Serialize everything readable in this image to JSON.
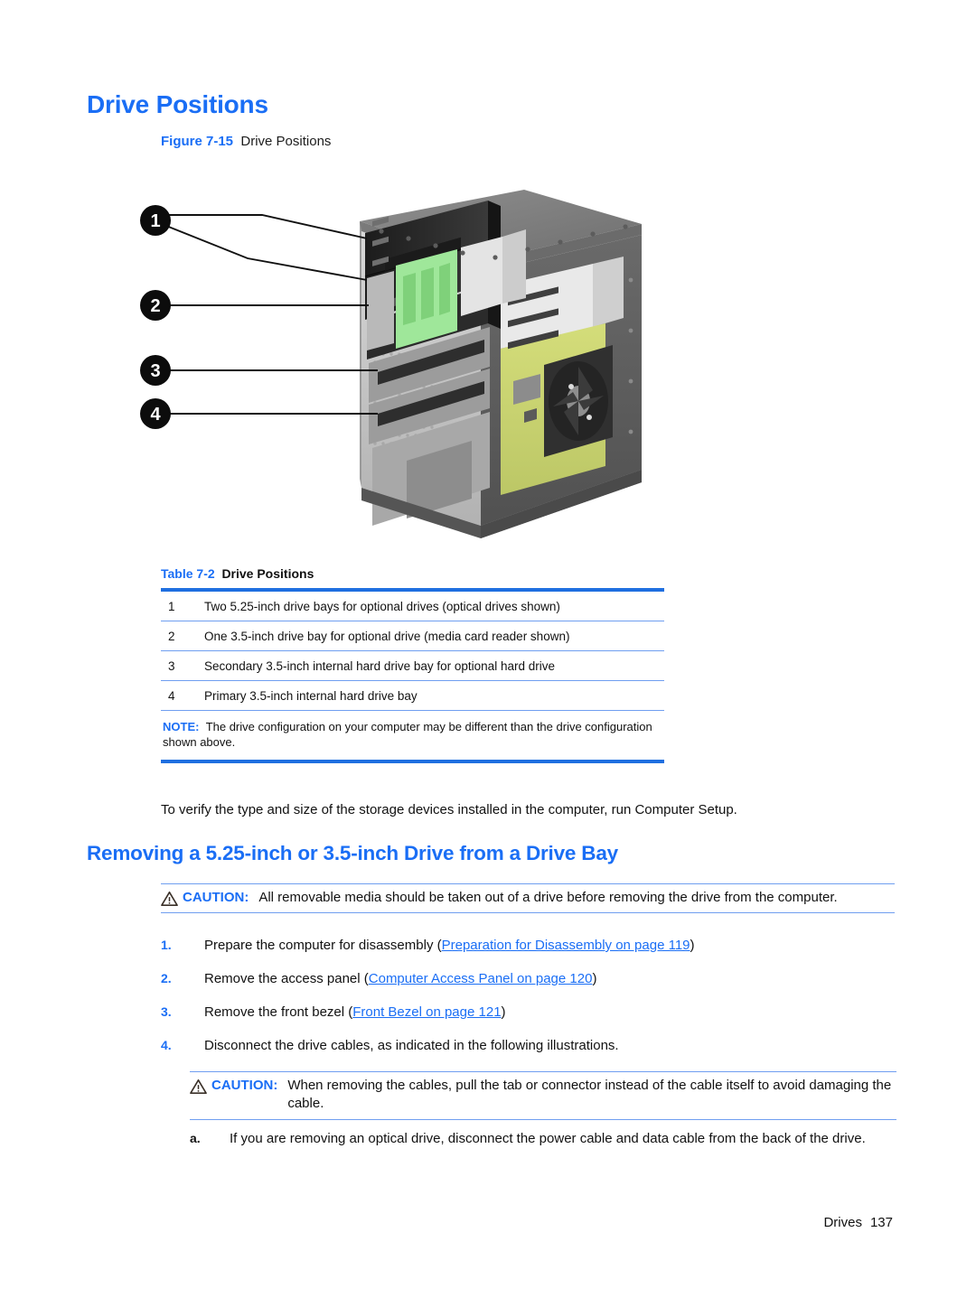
{
  "page": {
    "heading": "Drive Positions",
    "figure": {
      "number": "Figure 7-15",
      "title": "Drive Positions"
    },
    "illustration": {
      "alt_name": "computer-chassis-drive-positions-diagram",
      "callouts": [
        "1",
        "2",
        "3",
        "4"
      ]
    },
    "table": {
      "number": "Table 7-2",
      "title": "Drive Positions",
      "rows": [
        {
          "num": "1",
          "text": "Two 5.25-inch drive bays for optional drives (optical drives shown)"
        },
        {
          "num": "2",
          "text": "One 3.5-inch drive bay for optional drive (media card reader shown)"
        },
        {
          "num": "3",
          "text": "Secondary 3.5-inch internal hard drive bay for optional hard drive"
        },
        {
          "num": "4",
          "text": "Primary 3.5-inch internal hard drive bay"
        }
      ],
      "note_label": "NOTE:",
      "note_text": "The drive configuration on your computer may be different than the drive configuration shown above."
    },
    "body_paragraph": "To verify the type and size of the storage devices installed in the computer, run Computer Setup.",
    "section_heading": "Removing a 5.25-inch or 3.5-inch Drive from a Drive Bay",
    "caution_1": {
      "label": "CAUTION:",
      "text": "All removable media should be taken out of a drive before removing the drive from the computer."
    },
    "steps": [
      {
        "num": "1.",
        "prefix": "Prepare the computer for disassembly (",
        "link": "Preparation for Disassembly on page 119",
        "suffix": ")"
      },
      {
        "num": "2.",
        "prefix": "Remove the access panel (",
        "link": "Computer Access Panel on page 120",
        "suffix": ")"
      },
      {
        "num": "3.",
        "prefix": "Remove the front bezel (",
        "link": "Front Bezel on page 121",
        "suffix": ")"
      },
      {
        "num": "4.",
        "prefix": "Disconnect the drive cables, as indicated in the following illustrations.",
        "link": "",
        "suffix": ""
      }
    ],
    "caution_2": {
      "label": "CAUTION:",
      "text": "When removing the cables, pull the tab or connector instead of the cable itself to avoid damaging the cable."
    },
    "substep": {
      "num": "a.",
      "text": "If you are removing an optical drive, disconnect the power cable and data cable from the back of the drive."
    },
    "footer": {
      "chapter": "Drives",
      "page_number": "137"
    },
    "colors": {
      "accent_blue": "#1a6ef5",
      "rule_blue": "#1f6fe0",
      "thin_rule_blue": "#6f9ef0",
      "text_black": "#111111"
    }
  }
}
